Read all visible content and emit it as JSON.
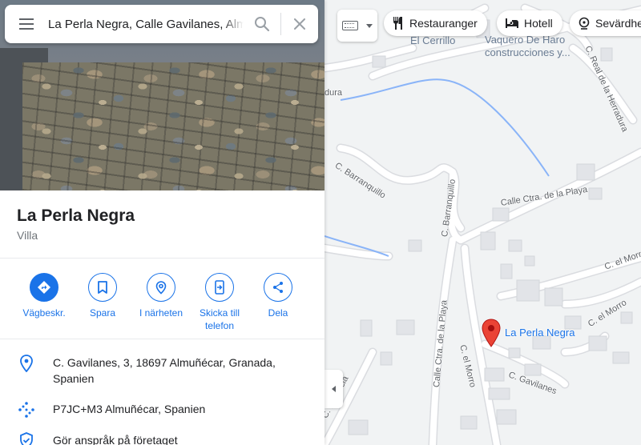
{
  "search": {
    "query": "La Perla Negra, Calle Gavilanes, Almuñécar"
  },
  "place": {
    "title": "La Perla Negra",
    "type": "Villa"
  },
  "actions": [
    {
      "label": "Vägbeskr."
    },
    {
      "label": "Spara"
    },
    {
      "label": "I närheten"
    },
    {
      "label": "Skicka till telefon"
    },
    {
      "label": "Dela"
    }
  ],
  "details": {
    "address": "C. Gavilanes, 3, 18697 Almuñécar, Granada, Spanien",
    "plus_code": "P7JC+M3 Almuñécar, Spanien",
    "claim": "Gör anspråk på företaget"
  },
  "chips": [
    {
      "label": "Restauranger",
      "icon": "restaurant-icon"
    },
    {
      "label": "Hotell",
      "icon": "hotel-icon"
    },
    {
      "label": "Sevärdheter",
      "icon": "attraction-icon"
    }
  ],
  "map": {
    "pin_label": "La Perla Negra",
    "poi": [
      {
        "label": "El Cerrillo"
      },
      {
        "label": "Vaquero De Haro construcciones y..."
      }
    ],
    "streets": {
      "herradura_top": "C. Real de la Herradura",
      "dura": "dura",
      "barranquillo_1": "C. Barranquillo",
      "barranquillo_2": "C. Barranquillo",
      "ctra_playa_1": "Calle Ctra. de la Playa",
      "ctra_playa_2": "Calle Ctra. de la Playa",
      "morro_1": "C. el Morro",
      "morro_2": "C. el Morro",
      "morro_3": "C. el Morro",
      "gavilanes": "C. Gavilanes",
      "herencia": "C. Herencia"
    },
    "colors": {
      "pin": "#ea4335",
      "water": "#8ab4f8",
      "road": "#ffffff",
      "building": "#e8eaed"
    }
  }
}
